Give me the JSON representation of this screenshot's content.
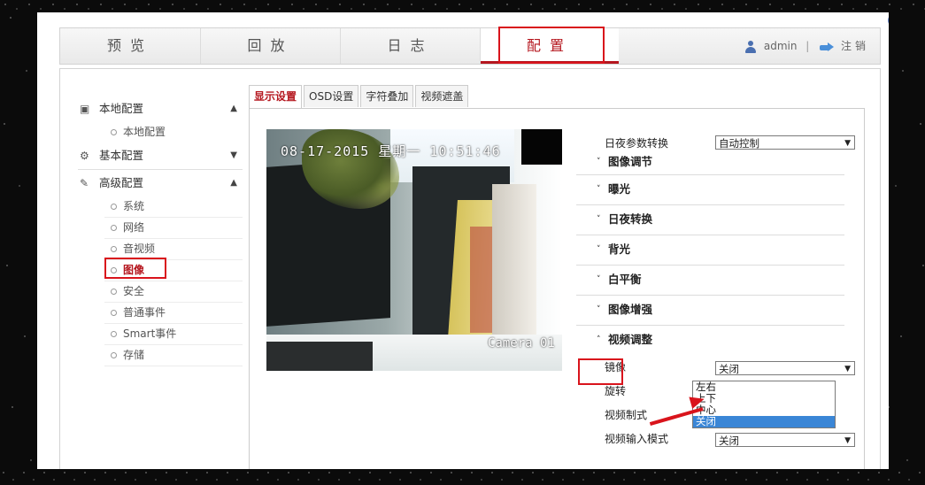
{
  "nav": {
    "tabs": [
      {
        "label": "预览"
      },
      {
        "label": "回放"
      },
      {
        "label": "日志"
      },
      {
        "label": "配置"
      }
    ],
    "user": "admin",
    "separator": "|",
    "logout": "注销"
  },
  "sidebar": {
    "local_config": "本地配置",
    "local_config_item": "本地配置",
    "basic_config": "基本配置",
    "advanced_config": "高级配置",
    "items": [
      {
        "label": "系统"
      },
      {
        "label": "网络"
      },
      {
        "label": "音视频"
      },
      {
        "label": "图像"
      },
      {
        "label": "安全"
      },
      {
        "label": "普通事件"
      },
      {
        "label": "Smart事件"
      },
      {
        "label": "存储"
      }
    ]
  },
  "content_tabs": [
    {
      "label": "显示设置"
    },
    {
      "label": "OSD设置"
    },
    {
      "label": "字符叠加"
    },
    {
      "label": "视频遮盖"
    }
  ],
  "video": {
    "osd_datetime": "08-17-2015 星期一 10:51:46",
    "camera_name": "Camera 01"
  },
  "panel": {
    "day_night_label": "日夜参数转换",
    "day_night_value": "自动控制",
    "groups": [
      {
        "label": "图像调节"
      },
      {
        "label": "曝光"
      },
      {
        "label": "日夜转换"
      },
      {
        "label": "背光"
      },
      {
        "label": "白平衡"
      },
      {
        "label": "图像增强"
      },
      {
        "label": "视频调整"
      }
    ],
    "mirror_label": "镜像",
    "mirror_value": "关闭",
    "rotate_label": "旋转",
    "video_standard_label": "视频制式",
    "video_input_mode_label": "视频输入模式",
    "video_input_mode_value": "关闭"
  },
  "mirror_dropdown": {
    "options": [
      {
        "label": "左右"
      },
      {
        "label": "上下"
      },
      {
        "label": "中心"
      },
      {
        "label": "关闭"
      }
    ],
    "selected": "关闭"
  },
  "colors": {
    "accent": "#b5171f",
    "highlight_box": "#d9141c",
    "selected_option": "#3a86d6"
  }
}
